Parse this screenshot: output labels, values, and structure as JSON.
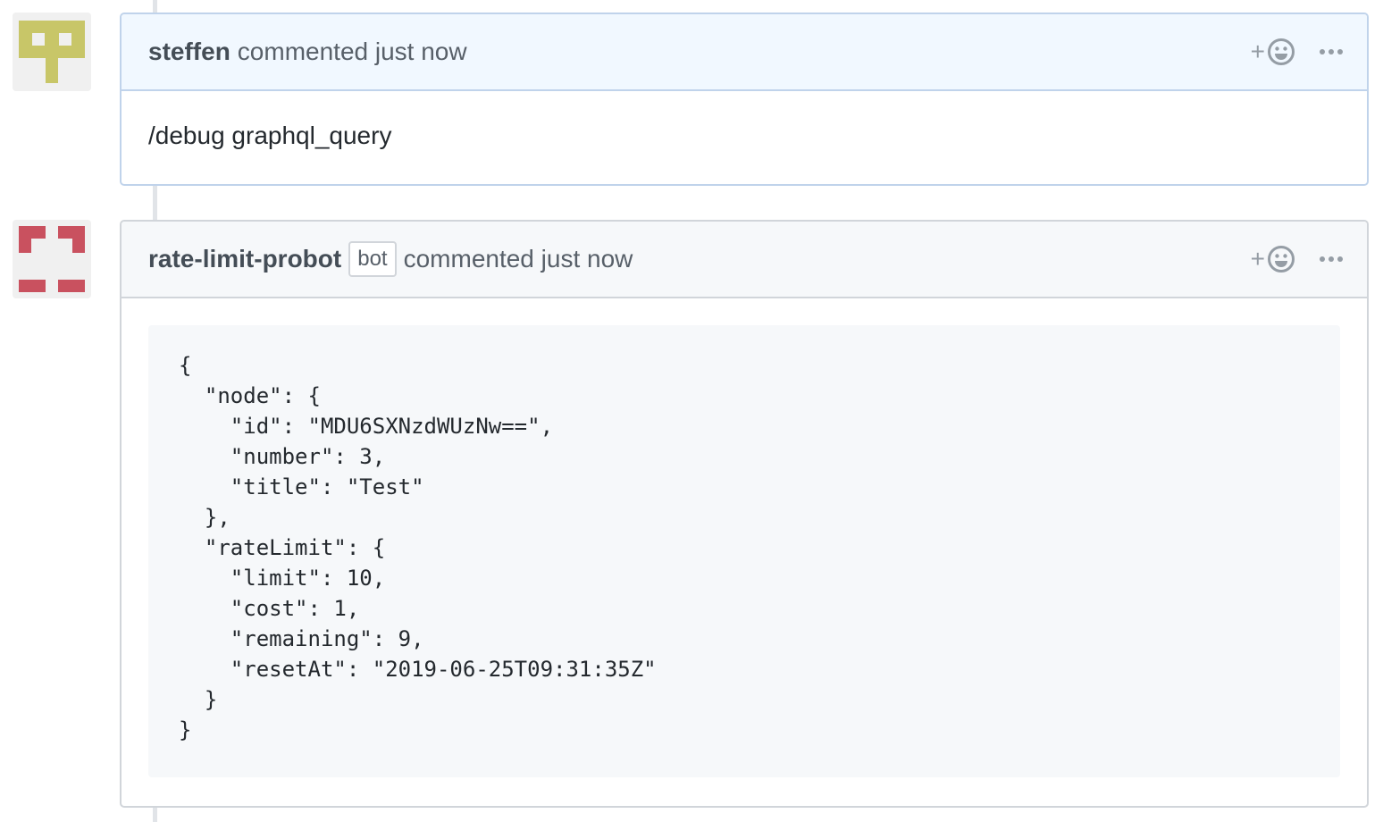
{
  "comments": [
    {
      "author": "steffen",
      "action_text": "commented just now",
      "body": "/debug graphql_query",
      "avatar_color": "#c8c668"
    },
    {
      "author": "rate-limit-probot",
      "badge": "bot",
      "action_text": "commented just now",
      "code": "{\n  \"node\": {\n    \"id\": \"MDU6SXNzdWUzNw==\",\n    \"number\": 3,\n    \"title\": \"Test\"\n  },\n  \"rateLimit\": {\n    \"limit\": 10,\n    \"cost\": 1,\n    \"remaining\": 9,\n    \"resetAt\": \"2019-06-25T09:31:35Z\"\n  }\n}",
      "avatar_color": "#c9515f"
    }
  ],
  "icons": {
    "reaction": "add-reaction-smiley-icon",
    "more": "kebab-horizontal-icon"
  },
  "reaction_plus": "+"
}
